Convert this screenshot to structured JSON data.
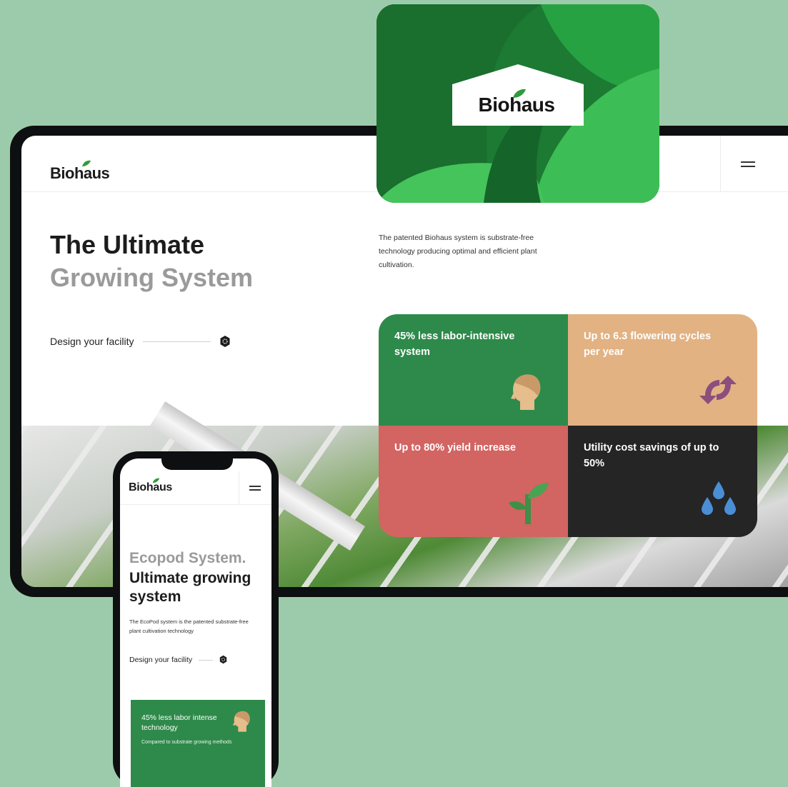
{
  "colors": {
    "background": "#9ccbab",
    "green": "#2e8a4a",
    "orange": "#e2b283",
    "red": "#d26462",
    "dark": "#252525",
    "brand_green": "#1f8c3b"
  },
  "brand_card": {
    "logo_text": "Biohaus"
  },
  "tablet": {
    "logo": "Biohaus",
    "menu_icon": "hamburger-icon",
    "headline_line1": "The Ultimate",
    "headline_line2": "Growing System",
    "description": "The patented Biohaus system is substrate-free technology producing optimal and efficient plant cultivation.",
    "cta_label": "Design your facility",
    "cta_icon": "gear-icon",
    "features": [
      {
        "label": "45% less labor-intensive system",
        "color": "#2e8a4a",
        "icon": "head-icon"
      },
      {
        "label": "Up to 6.3 flowering cycles per year",
        "color": "#e2b283",
        "icon": "cycle-arrows-icon"
      },
      {
        "label": "Up to 80% yield increase",
        "color": "#d26462",
        "icon": "sprout-icon"
      },
      {
        "label": "Utility cost savings of up to 50%",
        "color": "#252525",
        "icon": "water-drops-icon"
      }
    ]
  },
  "phone": {
    "logo": "Biohaus",
    "menu_icon": "hamburger-icon",
    "headline_line1": "Ecopod System.",
    "headline_line2": "Ultimate growing system",
    "description": "The EcoPod system is the patented substrate-free plant cultivation technology",
    "cta_label": "Design your facility",
    "card": {
      "title": "45% less labor intense technology",
      "subtitle": "Compared to substrate growing methods",
      "icon": "head-icon"
    }
  }
}
